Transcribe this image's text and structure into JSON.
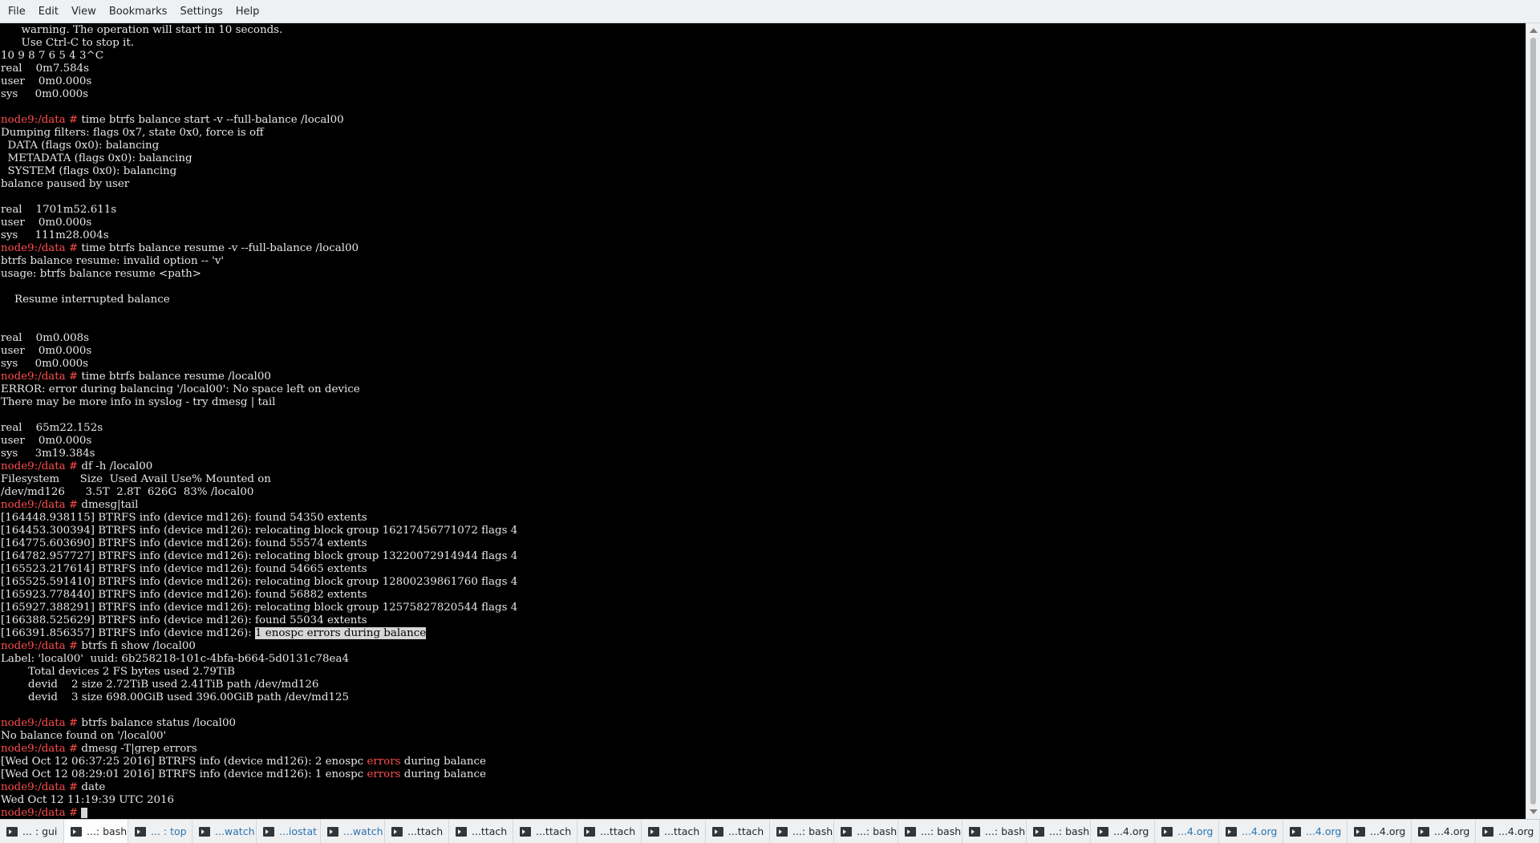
{
  "menu": [
    "File",
    "Edit",
    "View",
    "Bookmarks",
    "Settings",
    "Help"
  ],
  "terminal": {
    "lines": [
      [
        {
          "t": "      warning. The operation will start in 10 seconds."
        }
      ],
      [
        {
          "t": "      Use Ctrl-C to stop it."
        }
      ],
      [
        {
          "t": "10 9 8 7 6 5 4 3^C"
        }
      ],
      [
        {
          "t": "real    0m7.584s"
        }
      ],
      [
        {
          "t": "user    0m0.000s"
        }
      ],
      [
        {
          "t": "sys     0m0.000s"
        }
      ],
      [
        {
          "t": ""
        }
      ],
      [
        {
          "t": "node9:/data # ",
          "c": "prompt"
        },
        {
          "t": "time btrfs balance start -v --full-balance /local00"
        }
      ],
      [
        {
          "t": "Dumping filters: flags 0x7, state 0x0, force is off"
        }
      ],
      [
        {
          "t": "  DATA (flags 0x0): balancing"
        }
      ],
      [
        {
          "t": "  METADATA (flags 0x0): balancing"
        }
      ],
      [
        {
          "t": "  SYSTEM (flags 0x0): balancing"
        }
      ],
      [
        {
          "t": "balance paused by user"
        }
      ],
      [
        {
          "t": ""
        }
      ],
      [
        {
          "t": "real    1701m52.611s"
        }
      ],
      [
        {
          "t": "user    0m0.000s"
        }
      ],
      [
        {
          "t": "sys     111m28.004s"
        }
      ],
      [
        {
          "t": "node9:/data # ",
          "c": "prompt"
        },
        {
          "t": "time btrfs balance resume -v --full-balance /local00"
        }
      ],
      [
        {
          "t": "btrfs balance resume: invalid option -- 'v'"
        }
      ],
      [
        {
          "t": "usage: btrfs balance resume <path>"
        }
      ],
      [
        {
          "t": ""
        }
      ],
      [
        {
          "t": "    Resume interrupted balance"
        }
      ],
      [
        {
          "t": ""
        }
      ],
      [
        {
          "t": ""
        }
      ],
      [
        {
          "t": "real    0m0.008s"
        }
      ],
      [
        {
          "t": "user    0m0.000s"
        }
      ],
      [
        {
          "t": "sys     0m0.000s"
        }
      ],
      [
        {
          "t": "node9:/data # ",
          "c": "prompt"
        },
        {
          "t": "time btrfs balance resume /local00"
        }
      ],
      [
        {
          "t": "ERROR: error during balancing '/local00': No space left on device"
        }
      ],
      [
        {
          "t": "There may be more info in syslog - try dmesg | tail"
        }
      ],
      [
        {
          "t": ""
        }
      ],
      [
        {
          "t": "real    65m22.152s"
        }
      ],
      [
        {
          "t": "user    0m0.000s"
        }
      ],
      [
        {
          "t": "sys     3m19.384s"
        }
      ],
      [
        {
          "t": "node9:/data # ",
          "c": "prompt"
        },
        {
          "t": "df -h /local00"
        }
      ],
      [
        {
          "t": "Filesystem      Size  Used Avail Use% Mounted on"
        }
      ],
      [
        {
          "t": "/dev/md126      3.5T  2.8T  626G  83% /local00"
        }
      ],
      [
        {
          "t": "node9:/data # ",
          "c": "prompt"
        },
        {
          "t": "dmesg|tail"
        }
      ],
      [
        {
          "t": "[164448.938115] BTRFS info (device md126): found 54350 extents"
        }
      ],
      [
        {
          "t": "[164453.300394] BTRFS info (device md126): relocating block group 16217456771072 flags 4"
        }
      ],
      [
        {
          "t": "[164775.603690] BTRFS info (device md126): found 55574 extents"
        }
      ],
      [
        {
          "t": "[164782.957727] BTRFS info (device md126): relocating block group 13220072914944 flags 4"
        }
      ],
      [
        {
          "t": "[165523.217614] BTRFS info (device md126): found 54665 extents"
        }
      ],
      [
        {
          "t": "[165525.591410] BTRFS info (device md126): relocating block group 12800239861760 flags 4"
        }
      ],
      [
        {
          "t": "[165923.778440] BTRFS info (device md126): found 56882 extents"
        }
      ],
      [
        {
          "t": "[165927.388291] BTRFS info (device md126): relocating block group 12575827820544 flags 4"
        }
      ],
      [
        {
          "t": "[166388.525629] BTRFS info (device md126): found 55034 extents"
        }
      ],
      [
        {
          "t": "[166391.856357] BTRFS info (device md126): "
        },
        {
          "t": "1 enospc errors during balance",
          "c": "sel"
        }
      ],
      [
        {
          "t": "node9:/data # ",
          "c": "prompt"
        },
        {
          "t": "btrfs fi show /local00"
        }
      ],
      [
        {
          "t": "Label: 'local00'  uuid: 6b258218-101c-4bfa-b664-5d0131c78ea4"
        }
      ],
      [
        {
          "t": "        Total devices 2 FS bytes used 2.79TiB"
        }
      ],
      [
        {
          "t": "        devid    2 size 2.72TiB used 2.41TiB path /dev/md126"
        }
      ],
      [
        {
          "t": "        devid    3 size 698.00GiB used 396.00GiB path /dev/md125"
        }
      ],
      [
        {
          "t": ""
        }
      ],
      [
        {
          "t": "node9:/data # ",
          "c": "prompt"
        },
        {
          "t": "btrfs balance status /local00"
        }
      ],
      [
        {
          "t": "No balance found on '/local00'"
        }
      ],
      [
        {
          "t": "node9:/data # ",
          "c": "prompt"
        },
        {
          "t": "dmesg -T|grep errors"
        }
      ],
      [
        {
          "t": "[Wed Oct 12 06:37:25 2016] BTRFS info (device md126): 2 enospc "
        },
        {
          "t": "errors",
          "c": "err"
        },
        {
          "t": " during balance"
        }
      ],
      [
        {
          "t": "[Wed Oct 12 08:29:01 2016] BTRFS info (device md126): 1 enospc "
        },
        {
          "t": "errors",
          "c": "err"
        },
        {
          "t": " during balance"
        }
      ],
      [
        {
          "t": "node9:/data # ",
          "c": "prompt"
        },
        {
          "t": "date"
        }
      ],
      [
        {
          "t": "Wed Oct 12 11:19:39 UTC 2016"
        }
      ],
      [
        {
          "t": "node9:/data # ",
          "c": "prompt"
        },
        {
          "t": " ",
          "c": "cursor"
        }
      ]
    ]
  },
  "tabs": [
    {
      "label": "... : gui"
    },
    {
      "label": "...: bash",
      "active": true
    },
    {
      "label": "... : top",
      "activity": true
    },
    {
      "label": "...watch",
      "activity": true
    },
    {
      "label": "...iostat",
      "activity": true
    },
    {
      "label": "...watch",
      "activity": true
    },
    {
      "label": "...ttach"
    },
    {
      "label": "...ttach"
    },
    {
      "label": "...ttach"
    },
    {
      "label": "...ttach"
    },
    {
      "label": "...ttach"
    },
    {
      "label": "...ttach"
    },
    {
      "label": "...: bash"
    },
    {
      "label": "...: bash"
    },
    {
      "label": "...: bash"
    },
    {
      "label": "...: bash"
    },
    {
      "label": "...: bash"
    },
    {
      "label": "...4.org"
    },
    {
      "label": "...4.org",
      "activity": true
    },
    {
      "label": "...4.org",
      "activity": true
    },
    {
      "label": "...4.org",
      "activity": true
    },
    {
      "label": "...4.org"
    },
    {
      "label": "...4.org"
    },
    {
      "label": "...4.org"
    }
  ]
}
